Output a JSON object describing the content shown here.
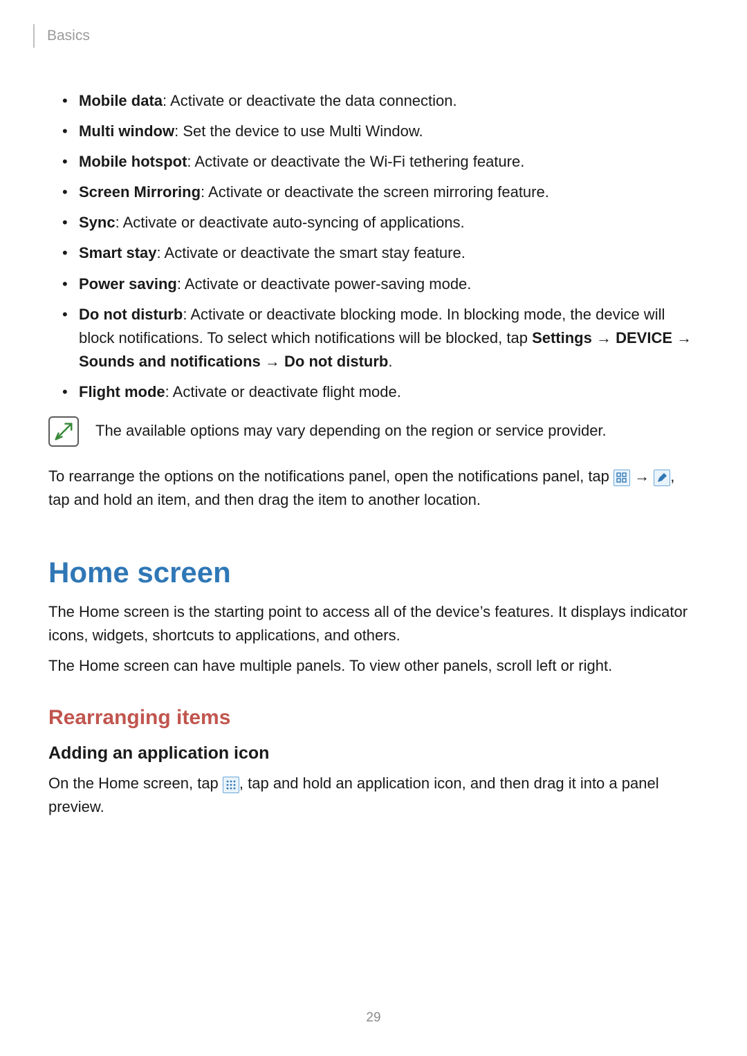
{
  "header": {
    "chapter": "Basics"
  },
  "features": [
    {
      "term": "Mobile data",
      "desc": ": Activate or deactivate the data connection."
    },
    {
      "term": "Multi window",
      "desc": ": Set the device to use Multi Window."
    },
    {
      "term": "Mobile hotspot",
      "desc": ": Activate or deactivate the Wi-Fi tethering feature."
    },
    {
      "term": "Screen Mirroring",
      "desc": ": Activate or deactivate the screen mirroring feature."
    },
    {
      "term": "Sync",
      "desc": ": Activate or deactivate auto-syncing of applications."
    },
    {
      "term": "Smart stay",
      "desc": ": Activate or deactivate the smart stay feature."
    },
    {
      "term": "Power saving",
      "desc": ": Activate or deactivate power-saving mode."
    },
    {
      "term": "Do not disturb",
      "desc": ": Activate or deactivate blocking mode. In blocking mode, the device will block notifications. To select which notifications will be blocked, tap ",
      "path": [
        "Settings",
        "DEVICE",
        "Sounds and notifications",
        "Do not disturb"
      ],
      "trail": "."
    },
    {
      "term": "Flight mode",
      "desc": ": Activate or deactivate flight mode."
    }
  ],
  "note": "The available options may vary depending on the region or service provider.",
  "rearrange": {
    "pre": "To rearrange the options on the notifications panel, open the notifications panel, tap ",
    "post": ", tap and hold an item, and then drag the item to another location."
  },
  "home": {
    "title": "Home screen",
    "p1": "The Home screen is the starting point to access all of the device’s features. It displays indicator icons, widgets, shortcuts to applications, and others.",
    "p2": "The Home screen can have multiple panels. To view other panels, scroll left or right."
  },
  "rearranging": {
    "title": "Rearranging items",
    "adding_title": "Adding an application icon",
    "adding_pre": "On the Home screen, tap ",
    "adding_post": ", tap and hold an application icon, and then drag it into a panel preview."
  },
  "arrow": "→",
  "page_number": "29"
}
